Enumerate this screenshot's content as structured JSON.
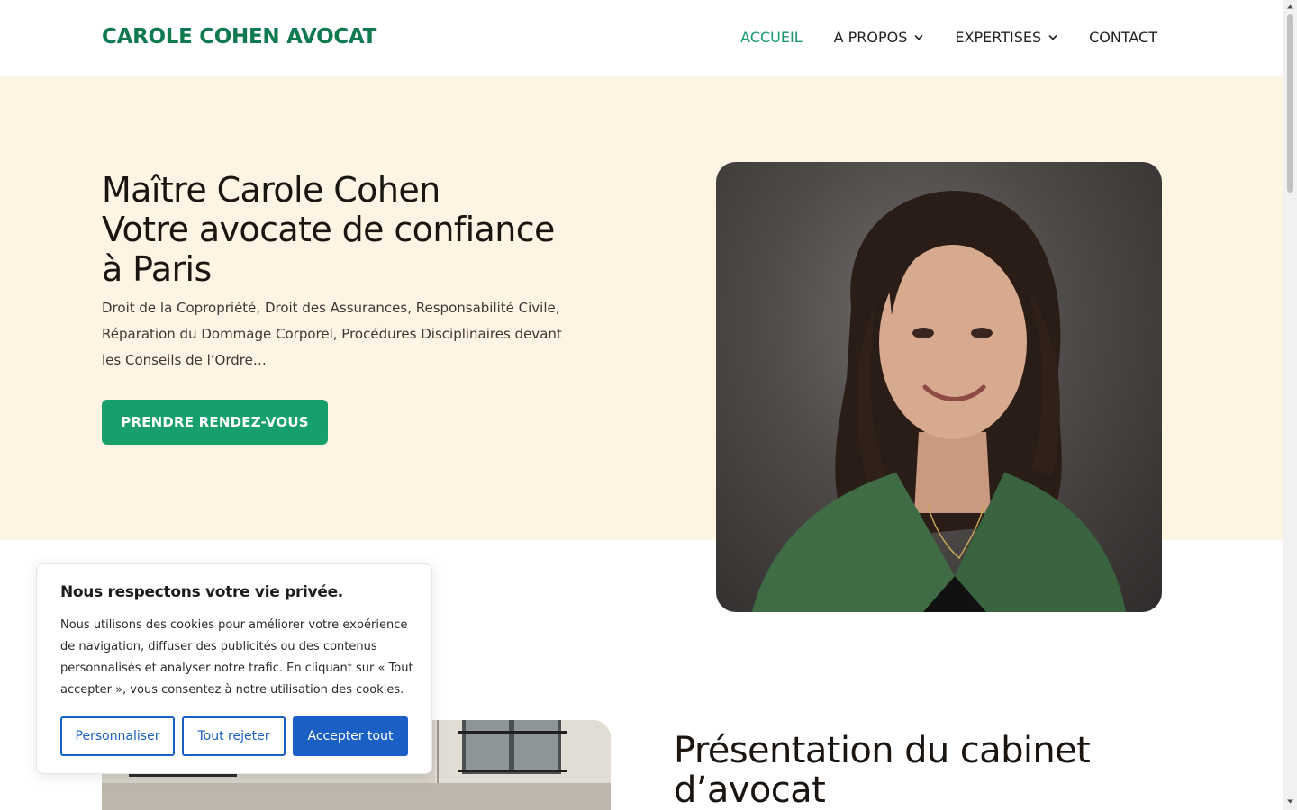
{
  "header": {
    "logo": "CAROLE COHEN AVOCAT",
    "nav": [
      {
        "label": "ACCUEIL",
        "active": true
      },
      {
        "label": "A PROPOS",
        "dropdown": true
      },
      {
        "label": "EXPERTISES",
        "dropdown": true
      },
      {
        "label": "CONTACT"
      }
    ]
  },
  "hero": {
    "title_line1": "Maître Carole Cohen",
    "title_line2": "Votre avocate de confiance",
    "title_line3": "à Paris",
    "description": "Droit de la Copropriété, Droit des Assurances, Responsabilité Civile, Réparation du Dommage Corporel, Procédures Disciplinaires devant les Conseils de l’Ordre…",
    "cta_label": "PRENDRE RENDEZ-VOUS"
  },
  "presentation": {
    "title_line1": "Présentation du cabinet",
    "title_line2": "d’avocat"
  },
  "cookie_banner": {
    "title": "Nous respectons votre vie privée.",
    "text": "Nous utilisons des cookies pour améliorer votre expérience de navigation, diffuser des publicités ou des contenus personnalisés et analyser notre trafic. En cliquant sur « Tout accepter », vous consentez à notre utilisation des cookies.",
    "customize_label": "Personnaliser",
    "reject_label": "Tout rejeter",
    "accept_label": "Accepter tout"
  },
  "colors": {
    "brand_green": "#0f7a4f",
    "active_nav": "#17996a",
    "cta_green": "#17a06c",
    "hero_bg": "#fef4e3",
    "cookie_blue": "#1a5fc4"
  },
  "icons": [
    "chevron-down-icon",
    "scroll-up-arrow-icon",
    "scroll-down-arrow-icon"
  ]
}
